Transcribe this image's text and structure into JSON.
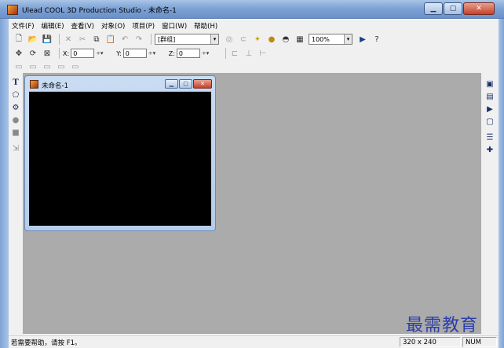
{
  "window": {
    "title": "Ulead COOL 3D Production Studio - 未命名-1",
    "minimize_glyph": "▁",
    "maximize_glyph": "▢",
    "close_glyph": "✕"
  },
  "menu": {
    "items": [
      "文件(F)",
      "编辑(E)",
      "查看(V)",
      "对象(O)",
      "项目(P)",
      "窗口(W)",
      "帮助(H)"
    ]
  },
  "toolbar": {
    "group_combo": "[群组]",
    "zoom_combo": "100%",
    "combo_arrow": "▾"
  },
  "position_bar": {
    "x_label": "X:",
    "x_value": "0",
    "y_label": "Y:",
    "y_value": "0",
    "z_label": "Z:",
    "z_value": "0",
    "spin_glyph": "÷▾"
  },
  "document": {
    "title": "未命名-1"
  },
  "statusbar": {
    "help_text": "若需要帮助，请按 F1。",
    "dimensions": "320 x 240",
    "num_lock": "NUM"
  },
  "watermark": {
    "text": "最需教育"
  },
  "icons": {
    "new": "🗋",
    "open": "📂",
    "save": "💾",
    "cut": "✂",
    "copy": "⧉",
    "paste": "📋",
    "undo": "↶",
    "redo": "↷",
    "globe": "◎",
    "link": "⊂",
    "help": "?",
    "text_tool": "T",
    "shape": "⬠",
    "move": "✥",
    "rotate": "⟳",
    "select": "⊠"
  },
  "colors": {
    "workspace": "#ababab",
    "canvas": "#000000",
    "watermark": "#2c3fa8"
  }
}
